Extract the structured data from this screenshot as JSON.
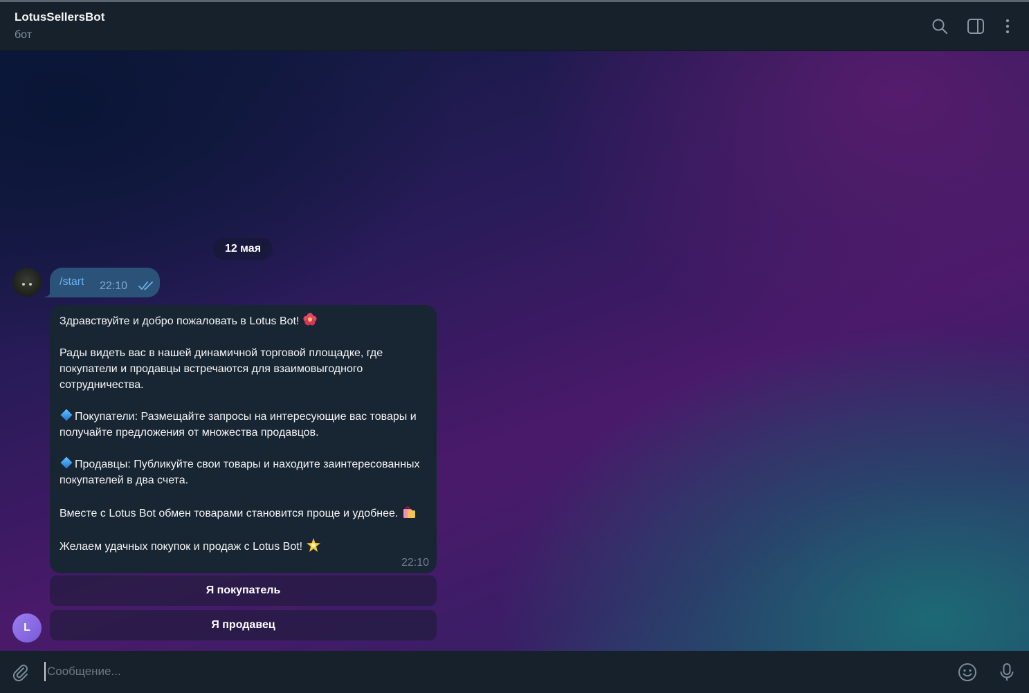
{
  "header": {
    "title": "LotusSellersBot",
    "subtitle": "бот",
    "icons": [
      "search-icon",
      "sidebar-toggle-icon",
      "more-vertical-icon"
    ]
  },
  "chat": {
    "date": "12 мая",
    "outgoing": {
      "text": "/start",
      "time": "22:10",
      "status": "read"
    },
    "incoming": {
      "lines": [
        "Здравствуйте и добро пожаловать в Lotus Bot!",
        "Рады видеть вас в нашей динамичной торговой площадке, где покупатели и продавцы встречаются для взаимовыгодного сотрудничества.",
        "Покупатели: Размещайте запросы на интересующие вас товары и получайте предложения от множества продавцов.",
        "Продавцы: Публикуйте свои товары и находите заинтересованных покупателей в два счета.",
        "Вместе с Lotus Bot обмен товарами становится проще и удобнее.",
        "Желаем удачных покупок и продаж с Lotus Bot!"
      ],
      "time": "22:10"
    },
    "buttons": [
      "Я покупатель",
      "Я продавец"
    ],
    "bot_avatar_letter": "L"
  },
  "composer": {
    "placeholder": "Сообщение...",
    "icons": [
      "attach-icon",
      "emoji-icon",
      "microphone-icon"
    ]
  },
  "colors": {
    "header_bg": "#17212b",
    "outgoing_bubble": "#2b5278",
    "incoming_bubble": "#182533",
    "link": "#6ab3f3",
    "muted": "#7f91a4"
  }
}
